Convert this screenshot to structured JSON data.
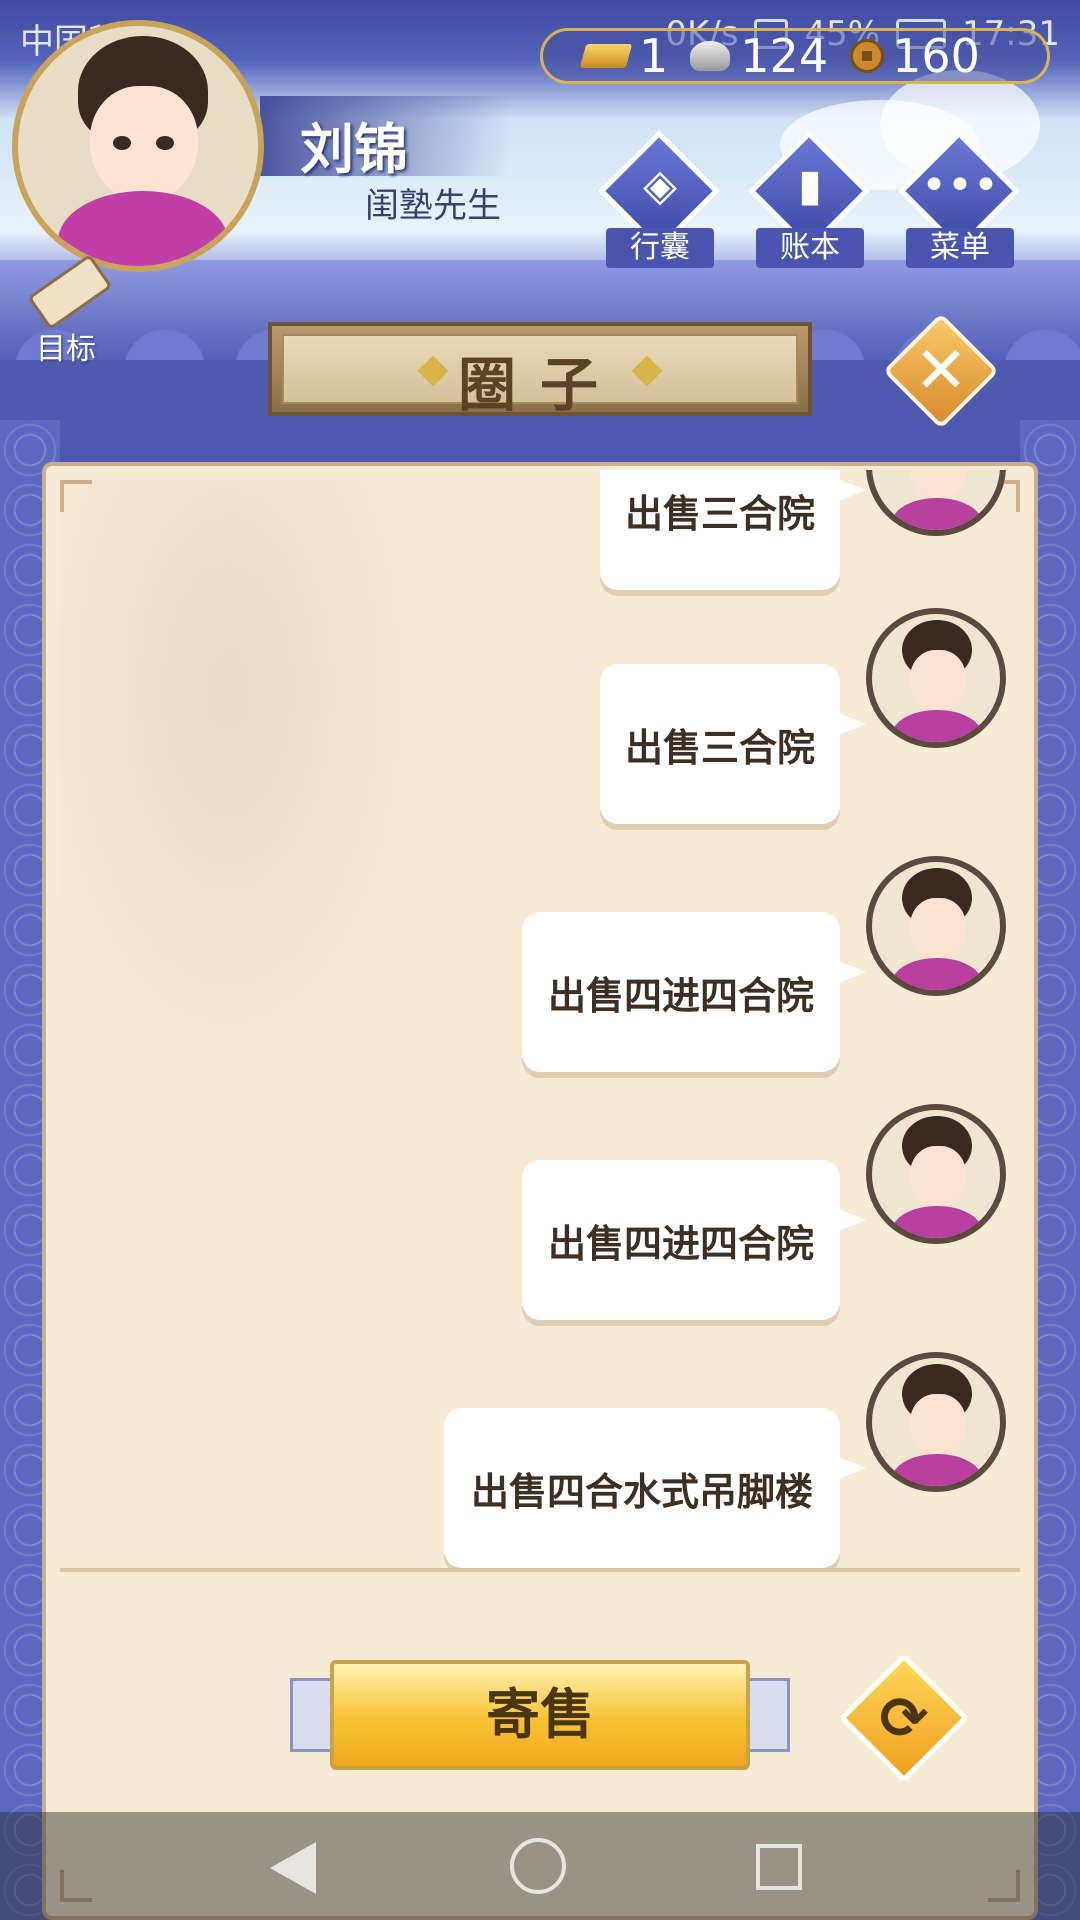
{
  "status_bar": {
    "carrier": "中国移动",
    "net_speed": "0K/s",
    "battery": "45%",
    "time": "17:31"
  },
  "currency": {
    "gold": "1",
    "silver": "124",
    "coins": "160"
  },
  "player": {
    "name": "刘锦",
    "title": "闺塾先生"
  },
  "goal": {
    "label": "目标"
  },
  "menu": [
    {
      "label": "行囊",
      "icon": "bag-icon"
    },
    {
      "label": "账本",
      "icon": "ledger-icon"
    },
    {
      "label": "菜单",
      "icon": "menu-dots-icon"
    }
  ],
  "panel": {
    "title": "圈子"
  },
  "messages": [
    {
      "text": "出售三合院"
    },
    {
      "text": "出售三合院"
    },
    {
      "text": "出售四进四合院"
    },
    {
      "text": "出售四进四合院"
    },
    {
      "text": "出售四合水式吊脚楼"
    }
  ],
  "actions": {
    "sell_label": "寄售",
    "refresh_glyph": "⟳",
    "close_glyph": "✕"
  },
  "colors": {
    "accent_gold": "#f7c232",
    "panel_bg": "#f6ecd6",
    "frame_blue": "#5560b8"
  }
}
